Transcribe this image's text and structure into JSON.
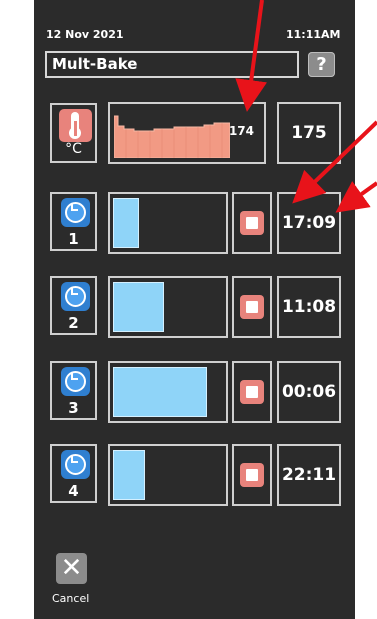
{
  "header": {
    "date": "12 Nov 2021",
    "time": "11:11AM"
  },
  "title": "Mult-Bake",
  "help_label": "?",
  "temperature": {
    "unit": "°C",
    "current": "174",
    "setpoint": "175"
  },
  "timers": [
    {
      "number": "1",
      "time": "17:09",
      "progress": 0.22
    },
    {
      "number": "2",
      "time": "11:08",
      "progress": 0.45
    },
    {
      "number": "3",
      "time": "00:06",
      "progress": 0.85
    },
    {
      "number": "4",
      "time": "22:11",
      "progress": 0.28
    }
  ],
  "cancel_label": "Cancel",
  "colors": {
    "panel": "#2b2b2b",
    "accent_red": "#e8837c",
    "timer_bar": "#8fd4f8",
    "annotation_arrow": "#e8131a"
  }
}
